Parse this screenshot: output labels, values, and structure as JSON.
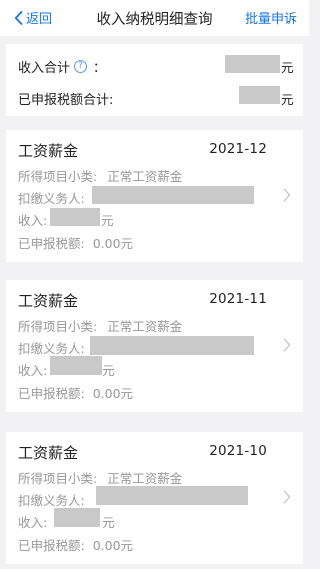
{
  "nav": {
    "back_label": "返回",
    "title": "收入纳税明细查询",
    "action_label": "批量申诉"
  },
  "summary": {
    "income_total_label": "收入合计",
    "income_total_colon": "：",
    "help_glyph": "?",
    "income_total_unit": "元",
    "tax_total_label": "已申报税额合计:",
    "tax_total_unit": "元"
  },
  "records": [
    {
      "title": "工资薪金",
      "period": "2021-12",
      "category_label": "所得项目小类:",
      "category_value": "正常工资薪金",
      "withholder_label": "扣缴义务人:",
      "income_label": "收入:",
      "income_unit": "元",
      "tax_label": "已申报税额:",
      "tax_value": "0.00元"
    },
    {
      "title": "工资薪金",
      "period": "2021-11",
      "category_label": "所得项目小类:",
      "category_value": "正常工资薪金",
      "withholder_label": "扣缴义务人:",
      "income_label": "收入:",
      "income_unit": "元",
      "tax_label": "已申报税额:",
      "tax_value": "0.00元"
    },
    {
      "title": "工资薪金",
      "period": "2021-10",
      "category_label": "所得项目小类:",
      "category_value": "正常工资薪金",
      "withholder_label": "扣缴义务人:",
      "income_label": "收入:",
      "income_unit": "元",
      "tax_label": "已申报税额:",
      "tax_value": "0.00元"
    }
  ],
  "icons": {
    "back": "chevron-left-icon",
    "help": "question-circle-icon",
    "row_arrow": "chevron-right-icon"
  },
  "colors": {
    "accent": "#1677e5",
    "secondary_text": "#999999",
    "redaction": "#c9c9c9"
  }
}
